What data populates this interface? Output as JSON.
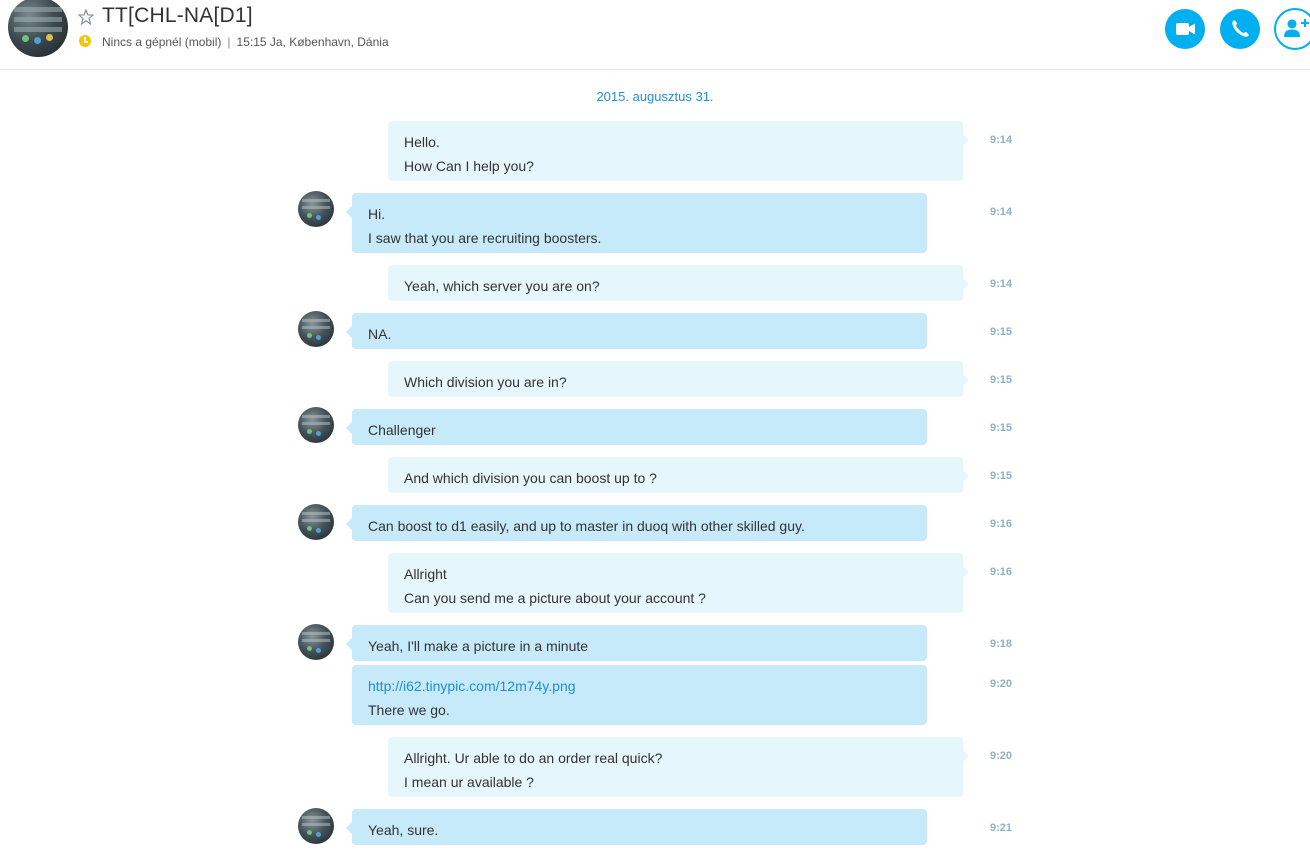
{
  "header": {
    "contact_name": "TT[CHL-NA[D1]",
    "status": "Nincs a gépnél (mobil)",
    "separator": "|",
    "local_time": "15:15 Ja, København, Dánia",
    "buttons": [
      "video-call",
      "audio-call",
      "add-participant"
    ],
    "accent": "#00aff0",
    "status_color": "#f9c400"
  },
  "chat": {
    "date": "2015. augusztus 31.",
    "messages": [
      {
        "from": "me",
        "lines": [
          "Hello.",
          "How Can I help you?"
        ],
        "time": "9:14"
      },
      {
        "from": "them",
        "lines": [
          "Hi.",
          "I saw that you are recruiting boosters."
        ],
        "time": "9:14"
      },
      {
        "from": "me",
        "lines": [
          "Yeah, which server you are on?"
        ],
        "time": "9:14"
      },
      {
        "from": "them",
        "lines": [
          "NA."
        ],
        "time": "9:15"
      },
      {
        "from": "me",
        "lines": [
          "Which division you are in?"
        ],
        "time": "9:15"
      },
      {
        "from": "them",
        "lines": [
          "Challenger"
        ],
        "time": "9:15"
      },
      {
        "from": "me",
        "lines": [
          "And which division you can boost up to ?"
        ],
        "time": "9:15"
      },
      {
        "from": "them",
        "lines": [
          "Can boost to d1 easily, and up to master in duoq with other skilled guy."
        ],
        "time": "9:16"
      },
      {
        "from": "me",
        "lines": [
          "Allright",
          "Can you send me a picture about your account ?"
        ],
        "time": "9:16"
      },
      {
        "from": "them",
        "lines": [
          "Yeah, I'll make a picture in a minute"
        ],
        "time": "9:18"
      },
      {
        "from": "them",
        "lines": [
          "http://i62.tinypic.com/12m74y.png",
          "There we go."
        ],
        "time": "9:20"
      },
      {
        "from": "me",
        "lines": [
          "Allright. Ur able to do an order real quick?",
          "I mean ur available ?"
        ],
        "time": "9:20"
      },
      {
        "from": "them",
        "lines": [
          "Yeah, sure."
        ],
        "time": "9:21"
      }
    ]
  }
}
